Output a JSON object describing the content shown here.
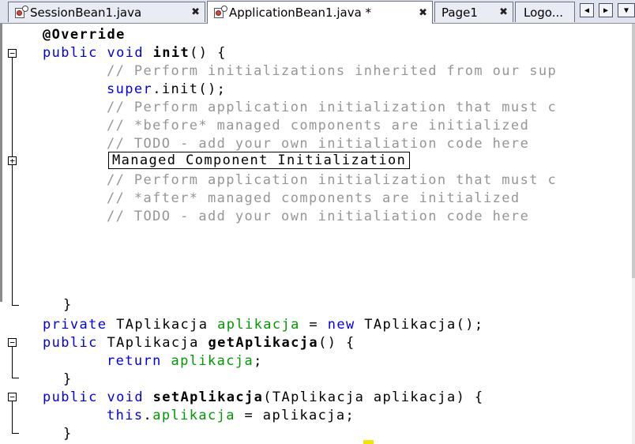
{
  "tabs": [
    {
      "label": "SessionBean1.java",
      "close": "✖",
      "active": false
    },
    {
      "label": "ApplicationBean1.java *",
      "close": "✖",
      "active": true
    },
    {
      "label": "Page1",
      "close": "✖",
      "active": false
    },
    {
      "label": "Logo...",
      "active": false
    }
  ],
  "nav": {
    "left": "◀",
    "right": "▶",
    "menu": "▼"
  },
  "code": {
    "l1": {
      "ann": "@Override"
    },
    "l2": {
      "kw": "public void ",
      "name": "init",
      "rest": "() {"
    },
    "l3": {
      "comment": "// Perform initializations inherited from our sup"
    },
    "l4": {
      "kw": "super",
      "rest": ".init();"
    },
    "l5": {
      "comment": "// Perform application initialization that must c"
    },
    "l6": {
      "comment": "// *before* managed components are initialized"
    },
    "l7": {
      "comment": "// TODO - add your own initialiation code here"
    },
    "l8": {
      "collapsed": "Managed Component Initialization"
    },
    "l9": {
      "comment": "// Perform application initialization that must c"
    },
    "l10": {
      "comment": "// *after* managed components are initialized"
    },
    "l11": {
      "comment": "// TODO - add your own initialiation code here"
    },
    "l12": {
      "brace": "}"
    },
    "l13": {
      "kw1": "private ",
      "type": "TAplikacja ",
      "field": "aplikacja",
      "eq": " = ",
      "kw2": "new ",
      "rest": "TAplikacja();"
    },
    "l14": {
      "kw": "public ",
      "type": "TAplikacja ",
      "name": "getAplikacja",
      "rest": "() {"
    },
    "l15": {
      "kw": "return ",
      "field": "aplikacja",
      "rest": ";"
    },
    "l16": {
      "brace": "}"
    },
    "l17": {
      "kw": "public void ",
      "name": "setAplikacja",
      "rest": "(TAplikacja aplikacja) {"
    },
    "l18": {
      "kw": "this",
      "dot": ".",
      "field": "aplikacja",
      "rest": " = aplikacja;"
    },
    "l19": {
      "brace": "}"
    }
  },
  "fold_markers": {
    "minus": "−",
    "plus": "+"
  }
}
